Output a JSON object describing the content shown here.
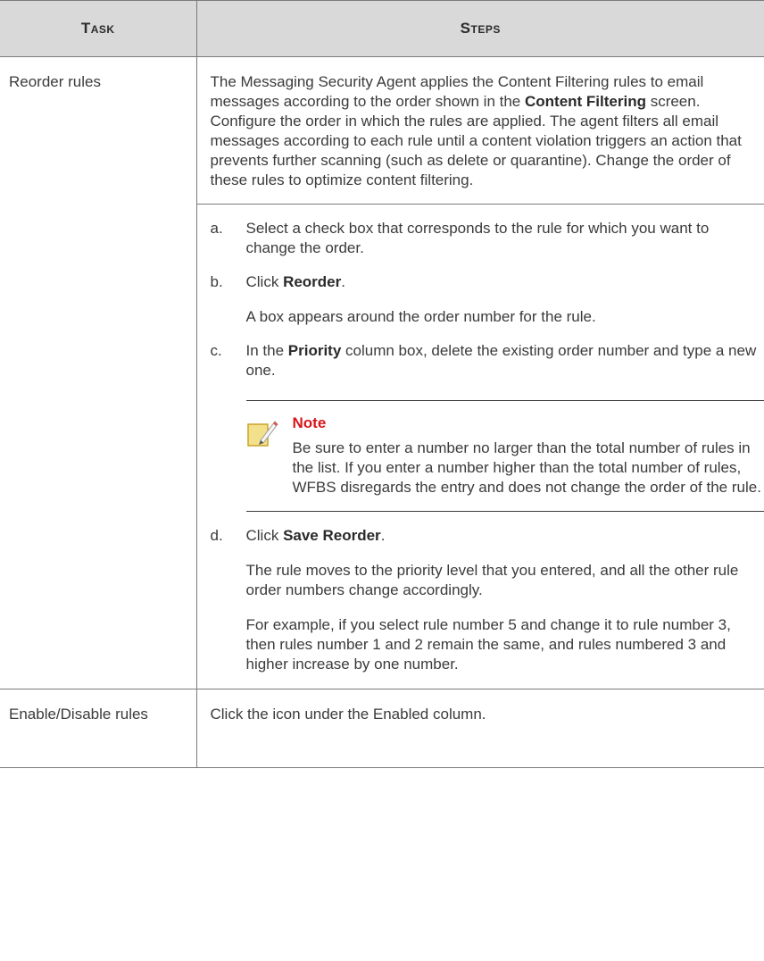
{
  "header": {
    "task": "Task",
    "steps": "Steps"
  },
  "row1": {
    "task": "Reorder rules",
    "intro_1": "The Messaging Security Agent applies the Content Filtering rules to email messages according to the order shown in the ",
    "intro_bold": "Content Filtering",
    "intro_2": " screen. Configure the order in which the rules are applied. The agent filters all email messages according to each rule until a content violation triggers an action that prevents further scanning (such as delete or quarantine). Change the order of these rules to optimize content filtering.",
    "step_a": {
      "letter": "a.",
      "text": "Select a check box that corresponds to the rule for which you want to change the order."
    },
    "step_b": {
      "letter": "b.",
      "pre": "Click ",
      "bold": "Reorder",
      "post": "."
    },
    "step_b_para": "A box appears around the order number for the rule.",
    "step_c": {
      "letter": "c.",
      "pre": "In the ",
      "bold": "Priority",
      "post": " column box, delete the existing order number and type a new one."
    },
    "note": {
      "title": "Note",
      "text": "Be sure to enter a number no larger than the total number of rules in the list. If you enter a number higher than the total number of rules, WFBS disregards the entry and does not change the order of the rule."
    },
    "step_d": {
      "letter": "d.",
      "pre": "Click ",
      "bold": "Save Reorder",
      "post": "."
    },
    "step_d_para1": "The rule moves to the priority level that you entered, and all the other rule order numbers change accordingly.",
    "step_d_para2": "For example, if you select rule number 5 and change it to rule number 3, then rules number 1 and 2 remain the same, and rules numbered 3 and higher increase by one number."
  },
  "row2": {
    "task": "Enable/Disable rules",
    "steps": "Click the icon under the Enabled column."
  }
}
